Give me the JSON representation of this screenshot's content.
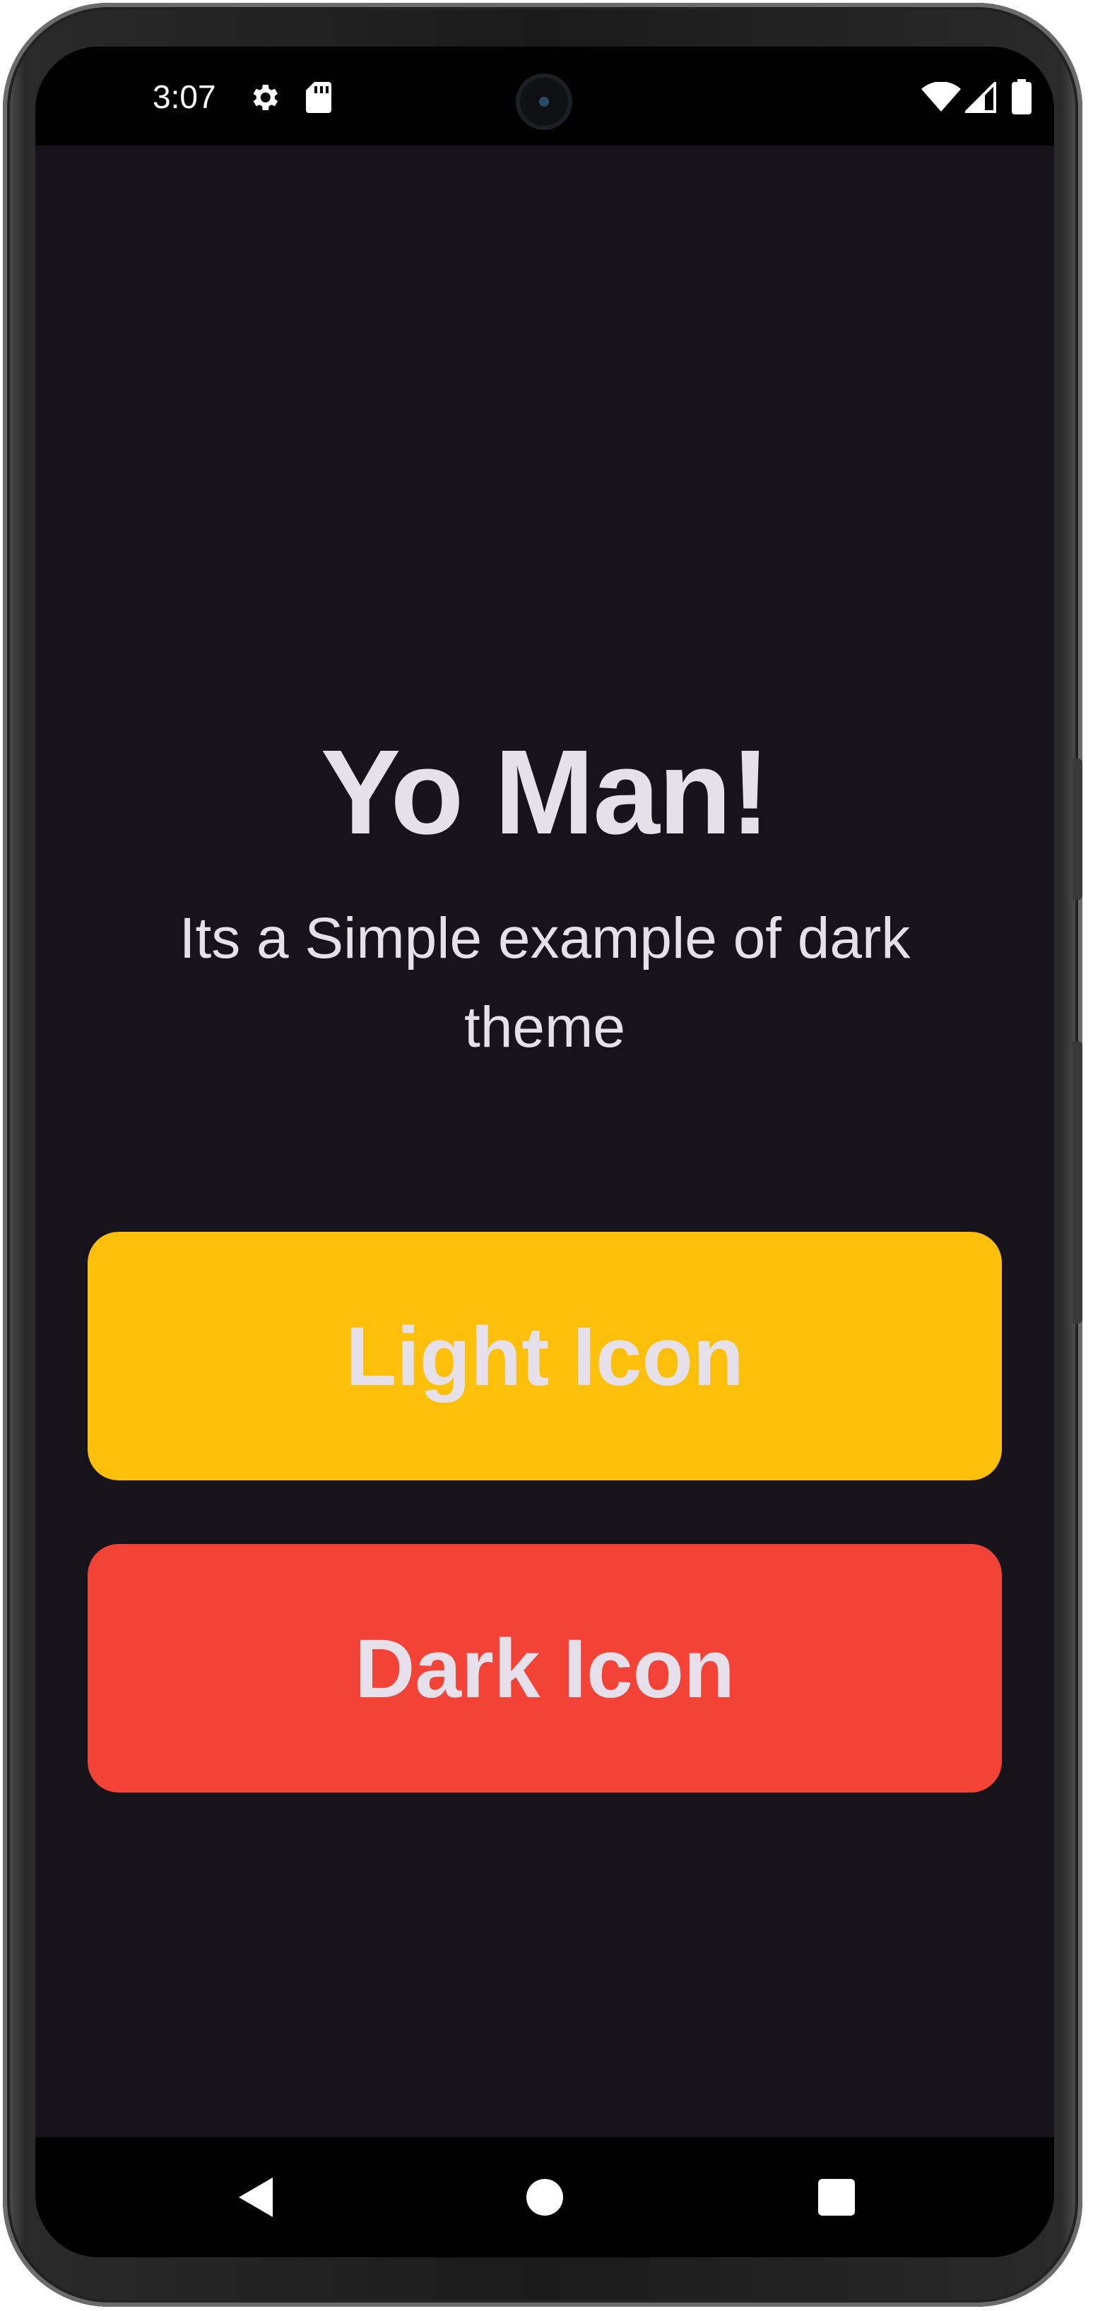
{
  "status_bar": {
    "time": "3:07",
    "left_icons": [
      "gear-icon",
      "sd-card-icon"
    ],
    "right_icons": [
      "wifi-icon",
      "signal-icon",
      "battery-icon"
    ]
  },
  "app": {
    "title": "Yo Man!",
    "subtitle": "Its a Simple example of dark theme",
    "background_color": "#16141a",
    "text_color": "#e6e0ea",
    "buttons": [
      {
        "label": "Light Icon",
        "color": "#fdc00a"
      },
      {
        "label": "Dark Icon",
        "color": "#f34337"
      }
    ]
  },
  "nav_bar": {
    "icons": [
      "back-icon",
      "home-icon",
      "recents-icon"
    ]
  }
}
